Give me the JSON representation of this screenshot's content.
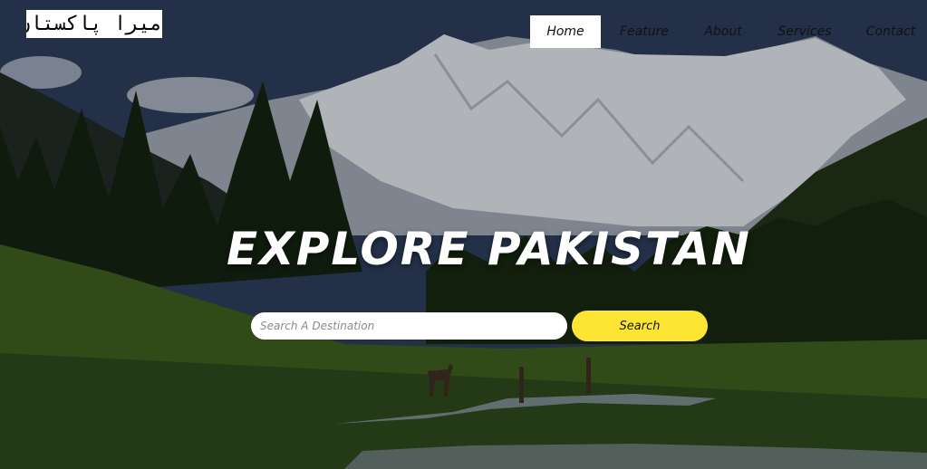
{
  "brand": {
    "logo_text": "میرا پاکستان"
  },
  "nav": {
    "items": [
      {
        "label": "Home",
        "active": true
      },
      {
        "label": "Feature"
      },
      {
        "label": "About"
      },
      {
        "label": "Services"
      },
      {
        "label": "Contact"
      }
    ]
  },
  "hero": {
    "title": "EXPLORE PAKISTAN",
    "search": {
      "placeholder": "Search A Destination",
      "value": "",
      "button_label": "Search"
    }
  },
  "colors": {
    "accent": "#ffe533",
    "nav_active_bg": "#ffffff"
  }
}
